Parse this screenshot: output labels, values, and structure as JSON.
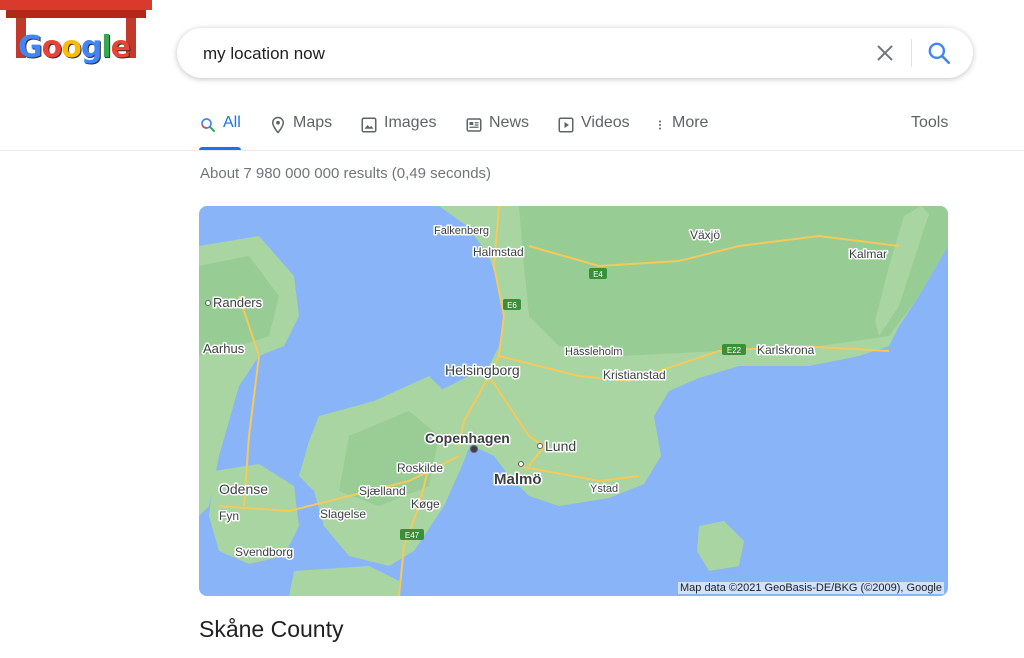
{
  "logo": {
    "text": "Google"
  },
  "search": {
    "query": "my location now",
    "clear_icon": "close-icon",
    "search_icon": "search-icon"
  },
  "tabs": [
    {
      "label": "All",
      "icon": "search-icon",
      "active": true
    },
    {
      "label": "Maps",
      "icon": "map-pin-icon"
    },
    {
      "label": "Images",
      "icon": "image-icon"
    },
    {
      "label": "News",
      "icon": "news-icon"
    },
    {
      "label": "Videos",
      "icon": "video-icon"
    },
    {
      "label": "More",
      "icon": "more-vertical-icon"
    }
  ],
  "tools_label": "Tools",
  "result_stats": "About 7 980 000 000 results (0,49 seconds)",
  "map": {
    "places": {
      "falkenberg": "Falkenberg",
      "halmstad": "Halmstad",
      "vaxjo": "Växjö",
      "kalmar": "Kalmar",
      "randers": "Randers",
      "aarhus": "Aarhus",
      "hassleholm": "Hässleholm",
      "karlskrona": "Karlskrona",
      "helsingborg": "Helsingborg",
      "kristianstad": "Kristianstad",
      "copenhagen": "Copenhagen",
      "lund": "Lund",
      "roskilde": "Roskilde",
      "malmo": "Malmö",
      "odense": "Odense",
      "sjaelland": "Sjælland",
      "koge": "Køge",
      "ystad": "Ystad",
      "fyn": "Fyn",
      "slagelse": "Slagelse",
      "svendborg": "Svendborg"
    },
    "roads": {
      "e4": "E4",
      "e6": "E6",
      "e22": "E22",
      "e47": "E47"
    },
    "attribution": "Map data ©2021 GeoBasis-DE/BKG (©2009), Google",
    "colors": {
      "water": "#8ab4f8",
      "land": "#a8d5a2",
      "land_dark": "#8cc68a",
      "road": "#f6c95a"
    }
  },
  "place_title": "Skåne County"
}
